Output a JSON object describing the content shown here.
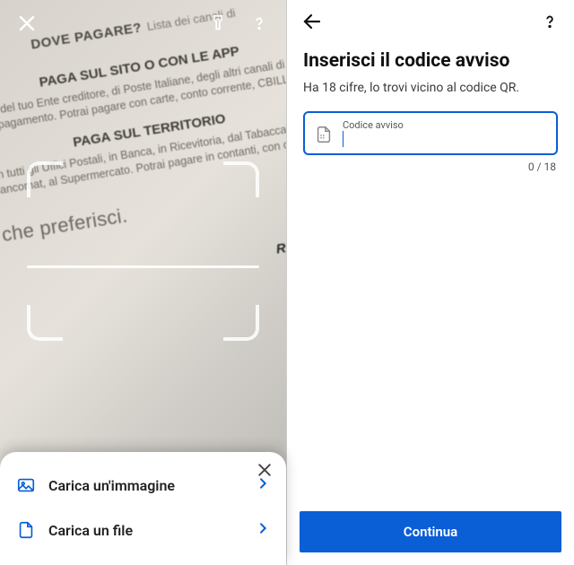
{
  "left": {
    "doc": {
      "h1": "DOVE PAGARE?",
      "h1_sub": "Lista dei canali di",
      "h2a": "PAGA SUL SITO O CON LE APP",
      "body_a": "del tuo Ente creditore, di Poste Italiane, degli altri canali di pagamento. Potrai pagare con carte, conto corrente, CBILL.",
      "h2b": "PAGA SUL TERRITORIO",
      "body_b": "in tutti gli Uffici Postali, in Banca, in Ricevitoria, dal Tabaccaio, al Bancomat, al Supermercato. Potrai pagare in contanti, con carte o",
      "bigline": "o che preferisci.",
      "rata": "RATA UNICA"
    },
    "sheet": {
      "row1": "Carica un'immagine",
      "row2": "Carica un file"
    }
  },
  "right": {
    "title": "Inserisci il codice avviso",
    "subtitle": "Ha 18 cifre, lo trovi vicino al codice QR.",
    "field_label": "Codice avviso",
    "counter": "0 / 18",
    "continue": "Continua"
  }
}
